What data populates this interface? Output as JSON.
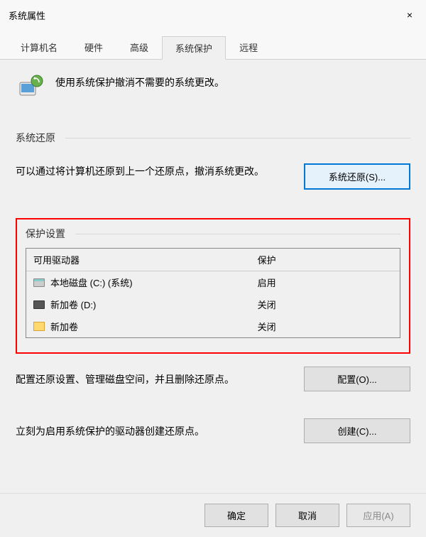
{
  "window": {
    "title": "系统属性",
    "close": "×"
  },
  "tabs": {
    "items": [
      {
        "label": "计算机名"
      },
      {
        "label": "硬件"
      },
      {
        "label": "高级"
      },
      {
        "label": "系统保护",
        "active": true
      },
      {
        "label": "远程"
      }
    ]
  },
  "intro": {
    "text": "使用系统保护撤消不需要的系统更改。"
  },
  "restore": {
    "title": "系统还原",
    "text": "可以通过将计算机还原到上一个还原点，撤消系统更改。",
    "button": "系统还原(S)..."
  },
  "protection": {
    "title": "保护设置",
    "columns": {
      "name": "可用驱动器",
      "status": "保护"
    },
    "drives": [
      {
        "name": "本地磁盘 (C:) (系统)",
        "status": "启用",
        "icon": "local"
      },
      {
        "name": "新加卷 (D:)",
        "status": "关闭",
        "icon": "volume"
      },
      {
        "name": "新加卷",
        "status": "关闭",
        "icon": "folder"
      }
    ],
    "configure": {
      "text": "配置还原设置、管理磁盘空间，并且删除还原点。",
      "button": "配置(O)..."
    },
    "create": {
      "text": "立刻为启用系统保护的驱动器创建还原点。",
      "button": "创建(C)..."
    }
  },
  "buttons": {
    "ok": "确定",
    "cancel": "取消",
    "apply": "应用(A)"
  }
}
